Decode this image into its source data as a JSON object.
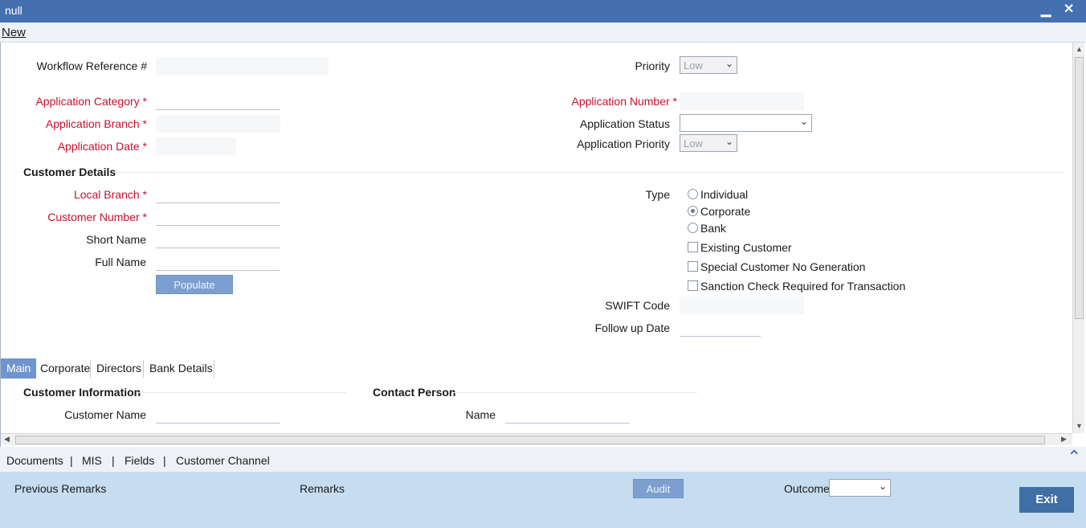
{
  "window": {
    "title": "null",
    "minimize_glyph": "▁",
    "close_glyph": "✕"
  },
  "menu": {
    "new_label": "New"
  },
  "form": {
    "workflow_ref_label": "Workflow Reference #",
    "priority_label": "Priority",
    "priority_value": "Low",
    "app_category_label": "Application Category",
    "app_number_label": "Application Number",
    "app_branch_label": "Application Branch",
    "app_status_label": "Application Status",
    "app_status_value": "",
    "app_date_label": "Application Date",
    "app_priority_label": "Application Priority",
    "app_priority_value": "Low",
    "required_mark": "*"
  },
  "customer_details": {
    "heading": "Customer Details",
    "local_branch_label": "Local Branch",
    "customer_number_label": "Customer Number",
    "short_name_label": "Short Name",
    "full_name_label": "Full Name",
    "populate_label": "Populate",
    "type_label": "Type",
    "type_options": [
      "Individual",
      "Corporate",
      "Bank"
    ],
    "type_selected": "Corporate",
    "existing_customer_label": "Existing Customer",
    "special_customer_label": "Special Customer No Generation",
    "sanction_check_label": "Sanction Check Required for Transaction",
    "swift_code_label": "SWIFT Code",
    "follow_up_date_label": "Follow up Date"
  },
  "tabs": [
    {
      "label": "Main",
      "active": true
    },
    {
      "label": "Corporate",
      "active": false
    },
    {
      "label": "Directors",
      "active": false
    },
    {
      "label": "Bank Details",
      "active": false
    }
  ],
  "main_tab": {
    "customer_info_heading": "Customer Information",
    "contact_person_heading": "Contact Person",
    "customer_name_label": "Customer Name",
    "name_label": "Name"
  },
  "links": [
    "Documents",
    "MIS",
    "Fields",
    "Customer Channel"
  ],
  "footer": {
    "previous_remarks_label": "Previous Remarks",
    "remarks_label": "Remarks",
    "audit_label": "Audit",
    "outcome_label": "Outcome",
    "outcome_value": "",
    "exit_label": "Exit"
  },
  "colors": {
    "titlebar": "#4470b0",
    "required": "#c8102e",
    "footer": "#c6dcf0",
    "exit_button": "#3f6fa5"
  }
}
